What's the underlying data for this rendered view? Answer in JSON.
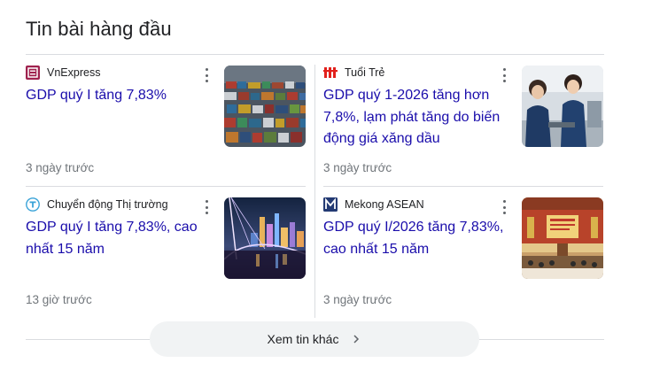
{
  "section": {
    "heading": "Tin bài hàng đầu"
  },
  "articles": [
    {
      "source": "VnExpress",
      "title": "GDP quý I tăng 7,83%",
      "time": "3 ngày trước",
      "logo_icon": "vnexpress-logo-icon",
      "thumb_icon": "container-port-thumbnail"
    },
    {
      "source": "Tuổi Trẻ",
      "title": "GDP quý 1-2026 tăng hơn 7,8%, lạm phát tăng do biến động giá xăng dầu",
      "time": "3 ngày trước",
      "logo_icon": "tuoitre-logo-icon",
      "thumb_icon": "factory-workers-thumbnail"
    },
    {
      "source": "Chuyển động Thị trường",
      "title": "GDP quý I tăng 7,83%, cao nhất 15 năm",
      "time": "13 giờ trước",
      "logo_icon": "chuyendong-logo-icon",
      "thumb_icon": "city-night-bridge-thumbnail"
    },
    {
      "source": "Mekong ASEAN",
      "title": "GDP quý I/2026 tăng 7,83%, cao nhất 15 năm",
      "time": "3 ngày trước",
      "logo_icon": "mekong-asean-logo-icon",
      "thumb_icon": "conference-hall-thumbnail"
    }
  ],
  "more": {
    "label": "Xem tin khác"
  },
  "colors": {
    "link": "#1a0dab",
    "meta": "#70757a",
    "divider": "#dadce0",
    "button_bg": "#f1f3f4"
  }
}
